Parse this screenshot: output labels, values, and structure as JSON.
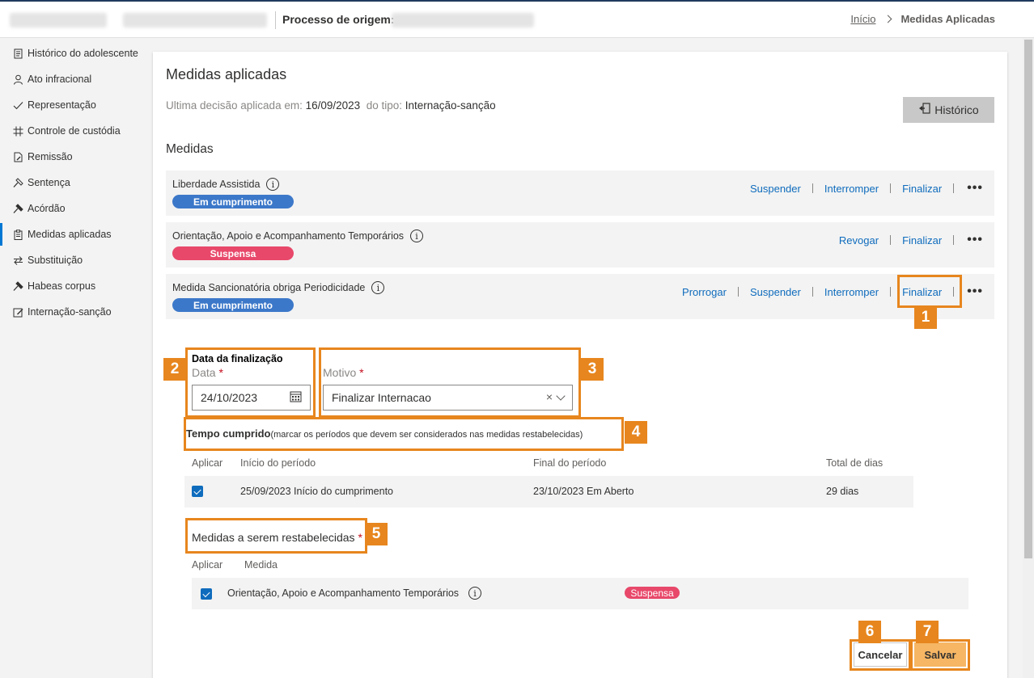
{
  "header": {
    "process_label": "Processo de origem:",
    "breadcrumb": {
      "home": "Início",
      "current": "Medidas Aplicadas"
    }
  },
  "sidebar": {
    "items": [
      {
        "label": "Histórico do adolescente",
        "icon": "document-icon"
      },
      {
        "label": "Ato infracional",
        "icon": "person-icon"
      },
      {
        "label": "Representação",
        "icon": "checkmark-icon"
      },
      {
        "label": "Controle de custódia",
        "icon": "grid-icon"
      },
      {
        "label": "Remissão",
        "icon": "document-edit-icon"
      },
      {
        "label": "Sentença",
        "icon": "gavel-icon"
      },
      {
        "label": "Acórdão",
        "icon": "gavel-icon"
      },
      {
        "label": "Medidas aplicadas",
        "icon": "clipboard-icon",
        "active": true
      },
      {
        "label": "Substituição",
        "icon": "swap-icon"
      },
      {
        "label": "Habeas corpus",
        "icon": "gavel-icon"
      },
      {
        "label": "Internação-sanção",
        "icon": "edit-icon"
      }
    ]
  },
  "main": {
    "title": "Medidas aplicadas",
    "decision_prefix": "Ultima decisão aplicada em:",
    "decision_date": "16/09/2023",
    "decision_type_prefix": "do tipo:",
    "decision_type": "Internação-sanção",
    "history_button": "Histórico",
    "medidas_heading": "Medidas",
    "medidas": [
      {
        "name": "Liberdade Assistida",
        "status": "Em cumprimento",
        "actions": [
          "Suspender",
          "Interromper",
          "Finalizar"
        ]
      },
      {
        "name": "Orientação, Apoio e Acompanhamento Temporários",
        "status": "Suspensa",
        "actions": [
          "Revogar",
          "Finalizar"
        ]
      },
      {
        "name": "Medida Sancionatória obriga Periodicidade",
        "status": "Em cumprimento",
        "actions": [
          "Prorrogar",
          "Suspender",
          "Interromper",
          "Finalizar"
        ]
      }
    ],
    "more_label": "•••"
  },
  "form": {
    "date_section_title": "Data da finalização",
    "date_label": "Data",
    "date_value": "24/10/2023",
    "reason_label": "Motivo",
    "reason_value": "Finalizar Internacao",
    "required_mark": "*",
    "clear_glyph": "×",
    "tempo_title": "Tempo cumprido",
    "tempo_hint": "(marcar os períodos que devem ser considerados nas medidas restabelecidas)",
    "period_headers": [
      "Aplicar",
      "Início do período",
      "Final do período",
      "Total de dias"
    ],
    "periods": [
      {
        "start": "25/09/2023 Início do cumprimento",
        "end": "23/10/2023 Em Aberto",
        "total": "29 dias",
        "checked": true
      }
    ],
    "restore_label": "Medidas a serem restabelecidas",
    "restore_headers": [
      "Aplicar",
      "Medida"
    ],
    "restore_items": [
      {
        "name": "Orientação, Apoio e Acompanhamento Temporários",
        "status": "Suspensa",
        "checked": true
      }
    ],
    "cancel_button": "Cancelar",
    "save_button": "Salvar"
  },
  "annotations": [
    "1",
    "2",
    "3",
    "4",
    "5",
    "6",
    "7"
  ],
  "colors": {
    "accent_blue": "#0f6cbd",
    "badge_blue": "#3c78c9",
    "badge_red": "#e8486a",
    "annotation_orange": "#e7861e",
    "save_orange": "#f6b664"
  }
}
